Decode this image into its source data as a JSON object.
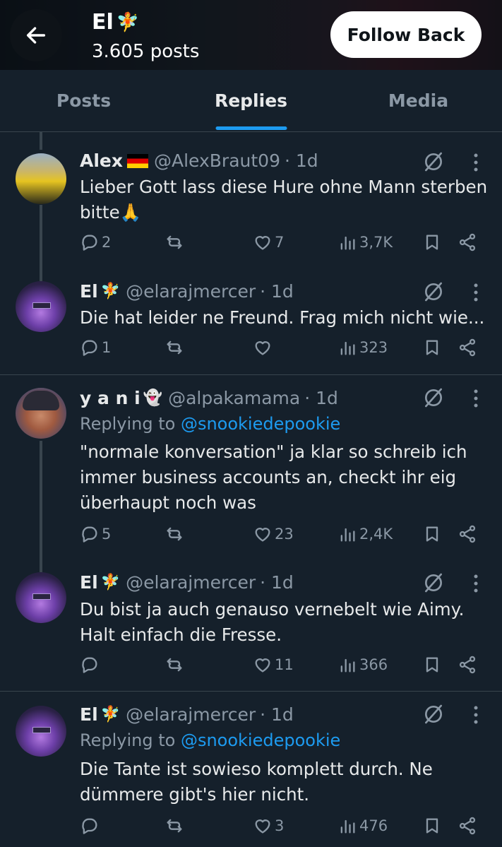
{
  "header": {
    "name": "El",
    "name_emoji": "🧚",
    "posts": "3.605 posts",
    "follow_button": "Follow Back"
  },
  "tabs": [
    {
      "label": "Posts",
      "active": false
    },
    {
      "label": "Replies",
      "active": true
    },
    {
      "label": "Media",
      "active": false
    }
  ],
  "tweets": [
    {
      "name": "Alex",
      "badge": "german-flag",
      "handle": "@AlexBraut09",
      "time": "· 1d",
      "replying_prefix": "",
      "replying_to": "",
      "text": "Lieber Gott lass diese Hure ohne Mann sterben bitte🙏",
      "replies": "2",
      "reposts": "",
      "likes": "7",
      "views": "3,7K"
    },
    {
      "name": "El",
      "name_emoji": "🧚",
      "handle": "@elarajmercer",
      "time": "· 1d",
      "replying_prefix": "",
      "replying_to": "",
      "text": "Die hat leider ne Freund. Frag mich nicht wie...",
      "replies": "1",
      "reposts": "",
      "likes": "",
      "views": "323"
    },
    {
      "name": "y a n i",
      "name_emoji": "👻",
      "handle": "@alpakamama",
      "time": "· 1d",
      "replying_prefix": "Replying to",
      "replying_to": "@snookiedepookie",
      "text": "\"normale konversation\" ja klar so schreib ich immer business accounts an, checkt ihr eig überhaupt noch was",
      "replies": "5",
      "reposts": "",
      "likes": "23",
      "views": "2,4K"
    },
    {
      "name": "El",
      "name_emoji": "🧚",
      "handle": "@elarajmercer",
      "time": "· 1d",
      "replying_prefix": "",
      "replying_to": "",
      "text": "Du bist ja auch genauso vernebelt wie Aimy. Halt einfach die Fresse.",
      "replies": "",
      "reposts": "",
      "likes": "11",
      "views": "366"
    },
    {
      "name": "El",
      "name_emoji": "🧚",
      "handle": "@elarajmercer",
      "time": "· 1d",
      "replying_prefix": "Replying to",
      "replying_to": "@snookiedepookie",
      "text": "Die Tante ist sowieso komplett durch. Ne dümmere gibt's hier nicht.",
      "replies": "",
      "reposts": "",
      "likes": "3",
      "views": "476"
    }
  ],
  "colors": {
    "background": "#15202b",
    "accent": "#1d9bf0",
    "muted_text": "#8b98a5",
    "divider": "#38444d"
  }
}
